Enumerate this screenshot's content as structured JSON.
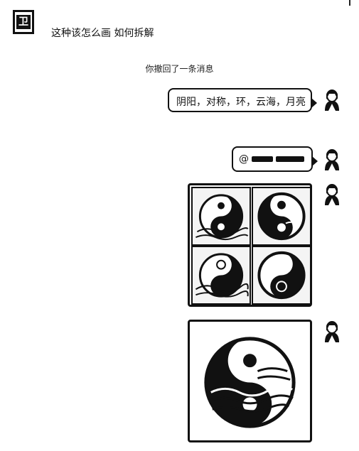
{
  "incoming_message": {
    "avatar_glyph": "卫",
    "text": "这种该怎么画 如何拆解"
  },
  "system_notice": "你撤回了一条消息",
  "outgoing_messages": [
    {
      "type": "text",
      "text": "阴阳，对称，环，云海，月亮"
    },
    {
      "type": "mention",
      "prefix": "@"
    },
    {
      "type": "image",
      "description_icon": "yin-yang-grid"
    },
    {
      "type": "image",
      "description_icon": "yin-yang-single"
    }
  ],
  "colors": {
    "ink": "#111111",
    "background": "#ffffff"
  }
}
